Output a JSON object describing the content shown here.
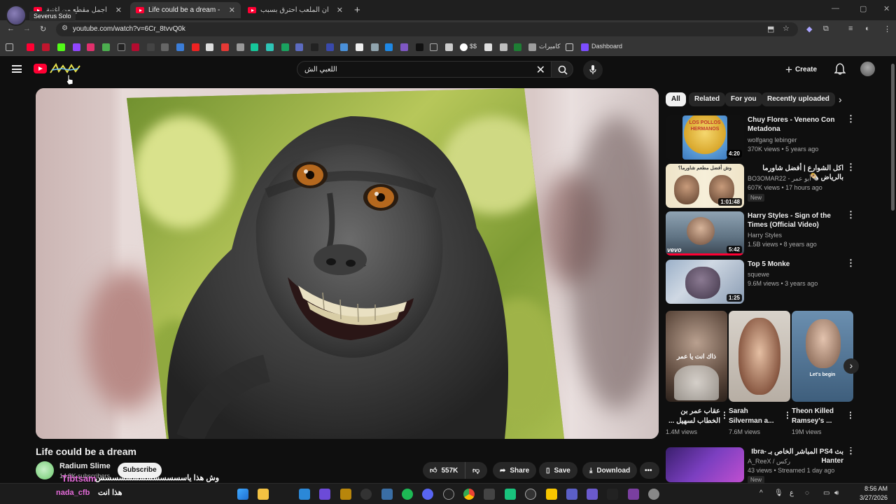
{
  "browser": {
    "tabs": [
      {
        "title": "أم كلثوم -- أجمل مقطع من أغنية"
      },
      {
        "title": "Life could be a dream - YouTube"
      },
      {
        "title": "يتفنعني ان الملعب احترق بسبب"
      }
    ],
    "tooltip": "Severus Solo",
    "url": "youtube.com/watch?v=6Cr_8tvvQ0k",
    "bookmarks": {
      "folder1": "كاميرات",
      "dollar": "$$",
      "dashboard": "Dashboard"
    }
  },
  "colors": {
    "brand": "#ff0033",
    "background": "#0f0f0f",
    "chip_bg": "#272727",
    "chat_name": "#e36ad8"
  },
  "header": {
    "search_query": "اللعبي الش",
    "create_label": "Create"
  },
  "video": {
    "title": "Life could be a dream",
    "channel": "Radium Slime",
    "subscribers": "14.8K subscribers",
    "subscribe_label": "Subscribe",
    "likes": "557K",
    "share_label": "Share",
    "save_label": "Save",
    "download_label": "Download"
  },
  "chat_overlay": [
    {
      "name": "Tibtsam",
      "message": "وش هذا ياسسسسسسسسسسسسس"
    },
    {
      "name": "nada_cfb",
      "message": "هذا انت"
    }
  ],
  "sidebar": {
    "chips": [
      "All",
      "Related",
      "For you",
      "Recently uploaded"
    ],
    "recommendations": [
      {
        "title": "Chuy Flores - Veneno Con Metadona",
        "channel": "wolfgang lebinger",
        "meta": "370K views • 5 years ago",
        "duration": "4:20",
        "thumb_text": "LOS POLLOS HERMANOS"
      },
      {
        "title": "اكل الشوارع | أفضل شاورما بالرياض 🌯",
        "channel": "BO3OMAR22 - أبو عمر",
        "meta": "607K views • 17 hours ago",
        "duration": "1:01:48",
        "badge": "New",
        "thumb_text": "وش أفضل مطعم شاورما؟"
      },
      {
        "title": "Harry Styles - Sign of the Times (Official Video)",
        "channel": "Harry Styles",
        "meta": "1.5B views • 8 years ago",
        "duration": "5:42",
        "thumb_text": "vevo"
      },
      {
        "title": "Top 5 Monke",
        "channel": "squewe",
        "meta": "9.6M views • 3 years ago",
        "duration": "1:25"
      }
    ],
    "shorts": [
      {
        "title": "عقاب عمر بن الخطاب لسهيل ...",
        "views": "1.4M views",
        "caption": "ذاك انت يا عمر"
      },
      {
        "title": "Sarah Silverman a...",
        "views": "7.6M views"
      },
      {
        "title": "Theon Killed Ramsey's ...",
        "views": "19M views",
        "caption": "Let's begin"
      }
    ],
    "live": {
      "title": "بث PS4 المباشر الخاص بـ Ibra-Hanter",
      "channel": "A_ReeX / رکس",
      "meta": "43 views • Streamed 1 day ago",
      "badge": "New"
    }
  },
  "taskbar": {
    "time": "8:56 AM",
    "date": "3/27/2026",
    "lang": "ع"
  }
}
